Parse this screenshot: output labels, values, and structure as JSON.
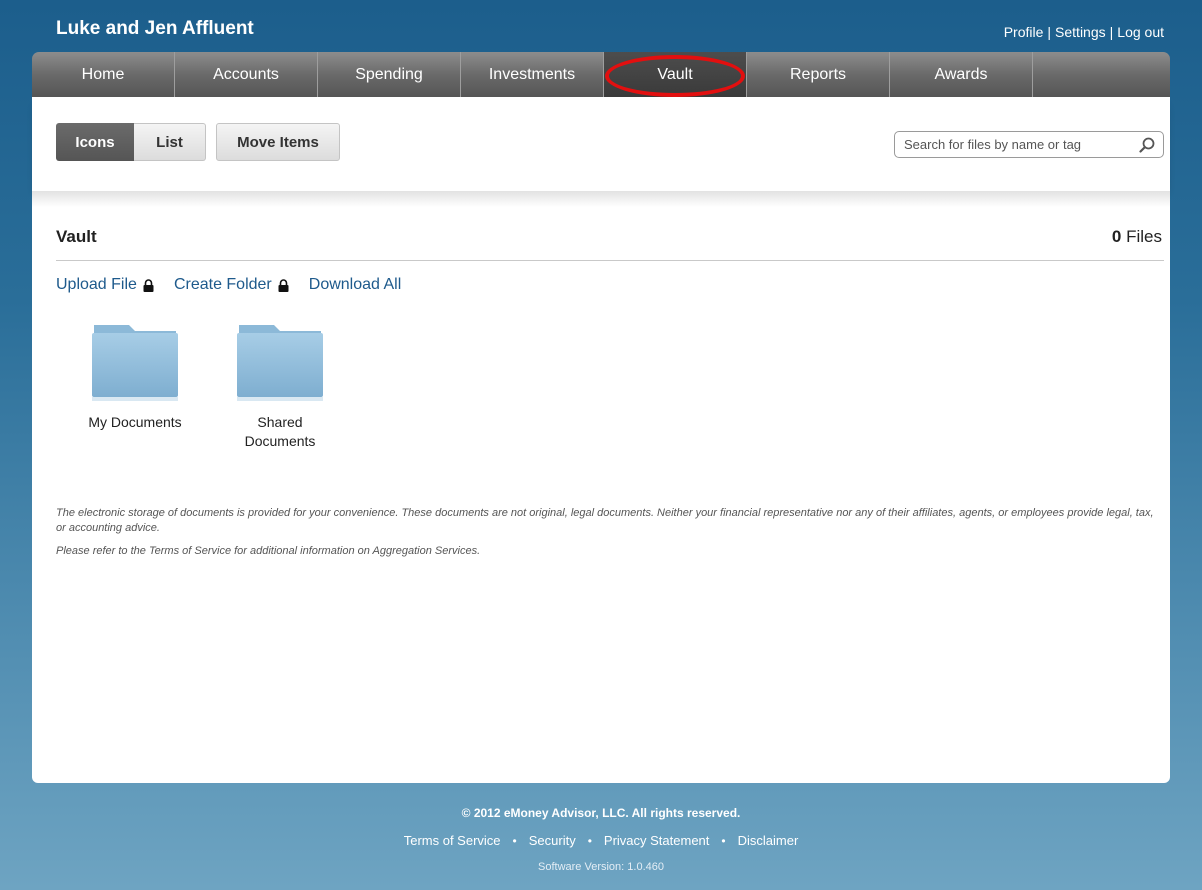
{
  "header": {
    "title": "Luke and Jen Affluent",
    "links": [
      "Profile",
      "Settings",
      "Log out"
    ],
    "separator": "|"
  },
  "nav": {
    "tabs": [
      "Home",
      "Accounts",
      "Spending",
      "Investments",
      "Vault",
      "Reports",
      "Awards"
    ],
    "active": "Vault",
    "highlight_color": "#e30f0f"
  },
  "toolbar": {
    "icons_label": "Icons",
    "list_label": "List",
    "move_label": "Move Items",
    "search_placeholder": "Search for files by name or tag",
    "search_value": ""
  },
  "vault": {
    "title": "Vault",
    "file_count": "0",
    "file_count_unit": "Files",
    "actions": {
      "upload": "Upload File",
      "create_folder": "Create Folder",
      "download_all": "Download All"
    },
    "folders": [
      {
        "name": "My Documents"
      },
      {
        "name": "Shared Documents"
      }
    ]
  },
  "disclaimer": {
    "line1": "The electronic storage of documents is provided for your convenience. These documents are not original, legal documents. Neither your financial representative nor any of their affiliates, agents, or employees provide legal, tax, or accounting advice.",
    "line2": "Please refer to the Terms of Service for additional information on Aggregation Services."
  },
  "footer": {
    "copyright": "© 2012 eMoney Advisor, LLC. All rights reserved.",
    "links": [
      "Terms of Service",
      "Security",
      "Privacy Statement",
      "Disclaimer"
    ],
    "link_separator": "•",
    "version": "Software Version: 1.0.460"
  },
  "colors": {
    "link_blue": "#1e5a8c",
    "nav_gray": "#6a6a6a",
    "folder_blue": "#8fbcd9"
  }
}
